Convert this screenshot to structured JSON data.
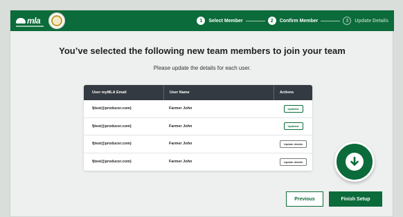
{
  "header": {
    "brand_text": "mla",
    "steps": [
      {
        "number": "1",
        "label": "Select Member",
        "state": "complete"
      },
      {
        "number": "2",
        "label": "Confirm Member",
        "state": "active"
      },
      {
        "number": "3",
        "label": "Update Details",
        "state": "upcoming"
      }
    ]
  },
  "main": {
    "title": "You’ve selected the following new team members to join your team",
    "subtitle": "Please update the details for each user."
  },
  "table": {
    "headers": [
      "User myMLA Email",
      "User Name",
      "Actions"
    ],
    "rows": [
      {
        "email": "fjtest@producer.com)",
        "name": "Farmer John",
        "action": "Updated",
        "status": "updated"
      },
      {
        "email": "fjtest@producer.com)",
        "name": "Farmer John",
        "action": "Updated",
        "status": "updated"
      },
      {
        "email": "fjtest@producer.com)",
        "name": "Farmer John",
        "action": "Update details",
        "status": "pending"
      },
      {
        "email": "fjtest@producer.com)",
        "name": "Farmer John",
        "action": "Update details",
        "status": "pending"
      }
    ]
  },
  "footer": {
    "previous_label": "Previous",
    "finish_label": "Finish Setup"
  },
  "fab": {
    "icon": "arrow-down-icon"
  },
  "colors": {
    "brand_green": "#0b6b3a",
    "table_header": "#333a41"
  }
}
